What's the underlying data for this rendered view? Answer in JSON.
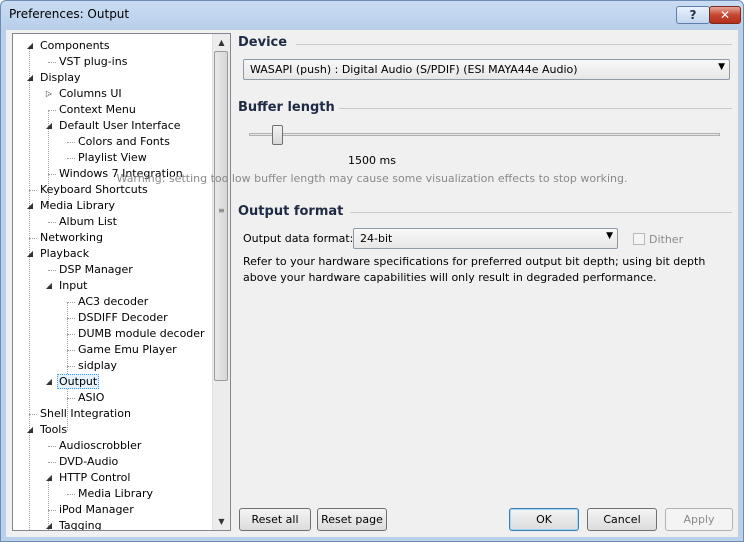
{
  "window": {
    "title": "Preferences: Output",
    "help_label": "?",
    "close_label": "✕"
  },
  "tree": {
    "items": [
      {
        "label": "Components",
        "expander": "◢"
      },
      {
        "label": "VST plug-ins",
        "expander": ""
      },
      {
        "label": "Display",
        "expander": "◢"
      },
      {
        "label": "Columns UI",
        "expander": "▷"
      },
      {
        "label": "Context Menu",
        "expander": ""
      },
      {
        "label": "Default User Interface",
        "expander": "◢"
      },
      {
        "label": "Colors and Fonts",
        "expander": ""
      },
      {
        "label": "Playlist View",
        "expander": ""
      },
      {
        "label": "Windows 7 Integration",
        "expander": ""
      },
      {
        "label": "Keyboard Shortcuts",
        "expander": ""
      },
      {
        "label": "Media Library",
        "expander": "◢"
      },
      {
        "label": "Album List",
        "expander": ""
      },
      {
        "label": "Networking",
        "expander": ""
      },
      {
        "label": "Playback",
        "expander": "◢"
      },
      {
        "label": "DSP Manager",
        "expander": ""
      },
      {
        "label": "Input",
        "expander": "◢"
      },
      {
        "label": "AC3 decoder",
        "expander": ""
      },
      {
        "label": "DSDIFF Decoder",
        "expander": ""
      },
      {
        "label": "DUMB module decoder",
        "expander": ""
      },
      {
        "label": "Game Emu Player",
        "expander": ""
      },
      {
        "label": "sidplay",
        "expander": ""
      },
      {
        "label": "Output",
        "expander": "◢"
      },
      {
        "label": "ASIO",
        "expander": ""
      },
      {
        "label": "Shell Integration",
        "expander": ""
      },
      {
        "label": "Tools",
        "expander": "◢"
      },
      {
        "label": "Audioscrobbler",
        "expander": ""
      },
      {
        "label": "DVD-Audio",
        "expander": ""
      },
      {
        "label": "HTTP Control",
        "expander": "◢"
      },
      {
        "label": "Media Library",
        "expander": ""
      },
      {
        "label": "iPod Manager",
        "expander": ""
      },
      {
        "label": "Tagging",
        "expander": "◢"
      }
    ],
    "selected": "Output",
    "scroll_up": "▲",
    "scroll_down": "▼",
    "grip": "≡"
  },
  "device": {
    "heading": "Device",
    "selected": "WASAPI (push) : Digital Audio (S/PDIF) (ESI MAYA44e Audio)",
    "arrow": "▼"
  },
  "buffer": {
    "heading": "Buffer length",
    "value_text": "1500 ms",
    "slider_fraction": 0.06,
    "warning": "Warning: setting too low buffer length may cause some visualization effects to stop working."
  },
  "output_format": {
    "heading": "Output format",
    "label": "Output data format:",
    "selected": "24-bit",
    "arrow": "▼",
    "dither_label": "Dither",
    "dither_checked": false,
    "description": "Refer to your hardware specifications for preferred output bit depth; using bit depth above your hardware capabilities will only result in degraded performance."
  },
  "buttons": {
    "reset_all": "Reset all",
    "reset_page": "Reset page",
    "ok": "OK",
    "cancel": "Cancel",
    "apply": "Apply"
  }
}
